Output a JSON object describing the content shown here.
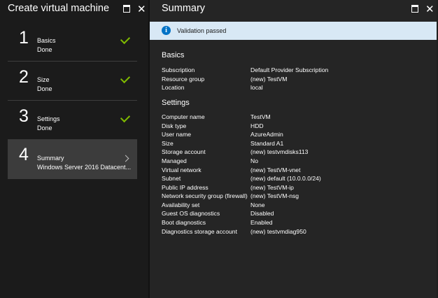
{
  "left_blade": {
    "title": "Create virtual machine",
    "steps": [
      {
        "number": "1",
        "name": "Basics",
        "status": "Done",
        "state": "complete"
      },
      {
        "number": "2",
        "name": "Size",
        "status": "Done",
        "state": "complete"
      },
      {
        "number": "3",
        "name": "Settings",
        "status": "Done",
        "state": "complete"
      },
      {
        "number": "4",
        "name": "Summary",
        "status": "Windows Server 2016 Datacent...",
        "state": "active"
      }
    ]
  },
  "right_blade": {
    "title": "Summary",
    "banner": {
      "icon": "info-icon",
      "text": "Validation passed",
      "color": "#d8e8f5"
    },
    "basics": {
      "heading": "Basics",
      "rows": [
        {
          "label": "Subscription",
          "value": "Default Provider Subscription"
        },
        {
          "label": "Resource group",
          "value": "(new) TestVM"
        },
        {
          "label": "Location",
          "value": "local"
        }
      ]
    },
    "settings": {
      "heading": "Settings",
      "rows": [
        {
          "label": "Computer name",
          "value": "TestVM"
        },
        {
          "label": "Disk type",
          "value": "HDD"
        },
        {
          "label": "User name",
          "value": "AzureAdmin"
        },
        {
          "label": "Size",
          "value": "Standard A1"
        },
        {
          "label": "Storage account",
          "value": "(new) testvmdisks113"
        },
        {
          "label": "Managed",
          "value": "No"
        },
        {
          "label": "Virtual network",
          "value": "(new) TestVM-vnet"
        },
        {
          "label": "Subnet",
          "value": "(new) default (10.0.0.0/24)"
        },
        {
          "label": "Public IP address",
          "value": "(new) TestVM-ip"
        },
        {
          "label": "Network security group (firewall)",
          "value": "(new) TestVM-nsg"
        },
        {
          "label": "Availability set",
          "value": "None"
        },
        {
          "label": "Guest OS diagnostics",
          "value": "Disabled"
        },
        {
          "label": "Boot diagnostics",
          "value": "Enabled"
        },
        {
          "label": "Diagnostics storage account",
          "value": "(new) testvmdiag950"
        }
      ]
    }
  },
  "colors": {
    "check": "#7fba00",
    "info": "#0072c6",
    "active_step": "#3c3c3c"
  }
}
